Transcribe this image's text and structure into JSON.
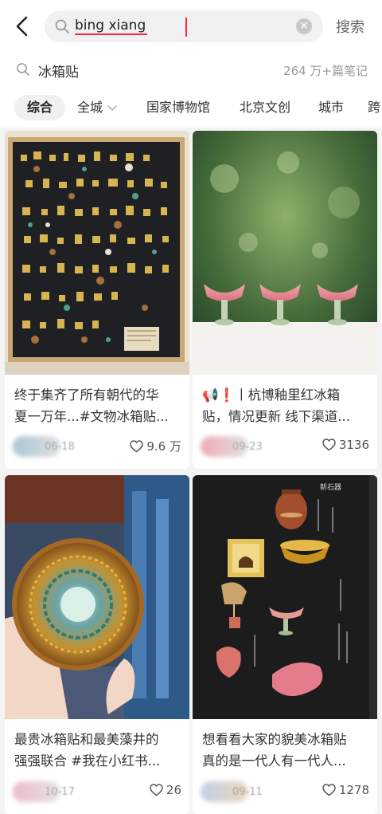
{
  "search": {
    "query": "bing xiang",
    "button_label": "搜索"
  },
  "suggestion": {
    "text": "冰箱贴",
    "count": "264 万+篇笔记"
  },
  "filters": [
    "综合",
    "全城",
    "国家博物馆",
    "北京文创",
    "城市",
    "跨"
  ],
  "notes": [
    {
      "title_line1": "终于集齐了所有朝代的华",
      "title_line2": "夏一万年...#文物冰箱贴...",
      "date": "06-18",
      "likes": "9.6 万"
    },
    {
      "title_line1": "📢❗丨杭博釉里红冰箱",
      "title_line2": "贴，情况更新 线下渠道...",
      "date": "09-23",
      "likes": "3136"
    },
    {
      "title_line1": "最贵冰箱贴和最美藻井的",
      "title_line2": "强强联合 #我在小红书...",
      "date": "10-17",
      "likes": "26"
    },
    {
      "title_line1": "想看看大家的貌美冰箱贴",
      "title_line2": "真的是一代人有一代人...",
      "date": "09-11",
      "likes": "1278"
    }
  ],
  "image_text": {
    "note4_label": "新石器"
  },
  "colors": {
    "accent": "#ff2442",
    "background": "#f4f4f4"
  },
  "icons": [
    "back-arrow-icon",
    "search-icon",
    "clear-icon",
    "chevron-down-icon",
    "heart-icon"
  ]
}
